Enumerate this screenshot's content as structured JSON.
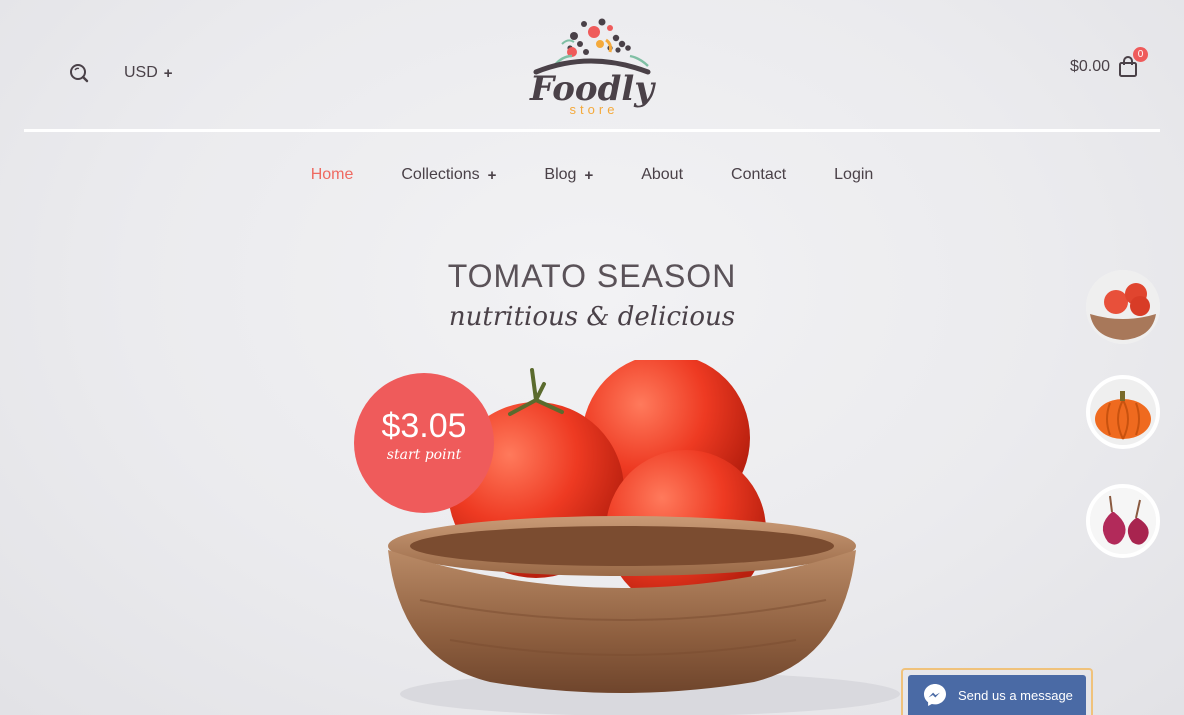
{
  "header": {
    "currency": "USD",
    "cart_total": "$0.00",
    "cart_count": "0",
    "logo": {
      "word": "Foodly",
      "sub": "store"
    }
  },
  "nav": {
    "items": [
      {
        "label": "Home",
        "active": true
      },
      {
        "label": "Collections",
        "has_submenu": true
      },
      {
        "label": "Blog",
        "has_submenu": true
      },
      {
        "label": "About"
      },
      {
        "label": "Contact"
      },
      {
        "label": "Login"
      }
    ]
  },
  "hero": {
    "title": "TOMATO SEASON",
    "subtitle": "nutritious & delicious",
    "price": "$3.05",
    "price_note": "start point"
  },
  "slider": {
    "thumbnails": [
      {
        "icon": "tomatoes-thumbnail",
        "active": true
      },
      {
        "icon": "pumpkin-thumbnail"
      },
      {
        "icon": "onions-thumbnail"
      }
    ]
  },
  "messenger": {
    "label": "Send us a message"
  },
  "colors": {
    "accent": "#ef5b5b",
    "text": "#4a4148",
    "messenger": "#4a6aa5"
  }
}
